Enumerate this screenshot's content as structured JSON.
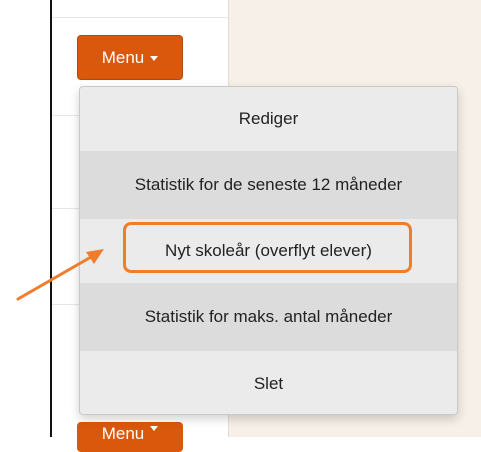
{
  "menu_button": {
    "label": "Menu"
  },
  "menu_button_bottom": {
    "label": "Menu"
  },
  "dropdown": {
    "items": [
      {
        "label": "Rediger"
      },
      {
        "label": "Statistik for de seneste 12 måneder"
      },
      {
        "label": "Nyt skoleår (overflyt elever)"
      },
      {
        "label": "Statistik for maks. antal måneder"
      },
      {
        "label": "Slet"
      }
    ]
  },
  "colors": {
    "menu_button": "#d9580c",
    "annotation": "#ef7d2b",
    "content_background": "#f6f0e8"
  },
  "icons": {
    "caret": "caret-down-icon",
    "arrow": "annotation-arrow-icon"
  }
}
